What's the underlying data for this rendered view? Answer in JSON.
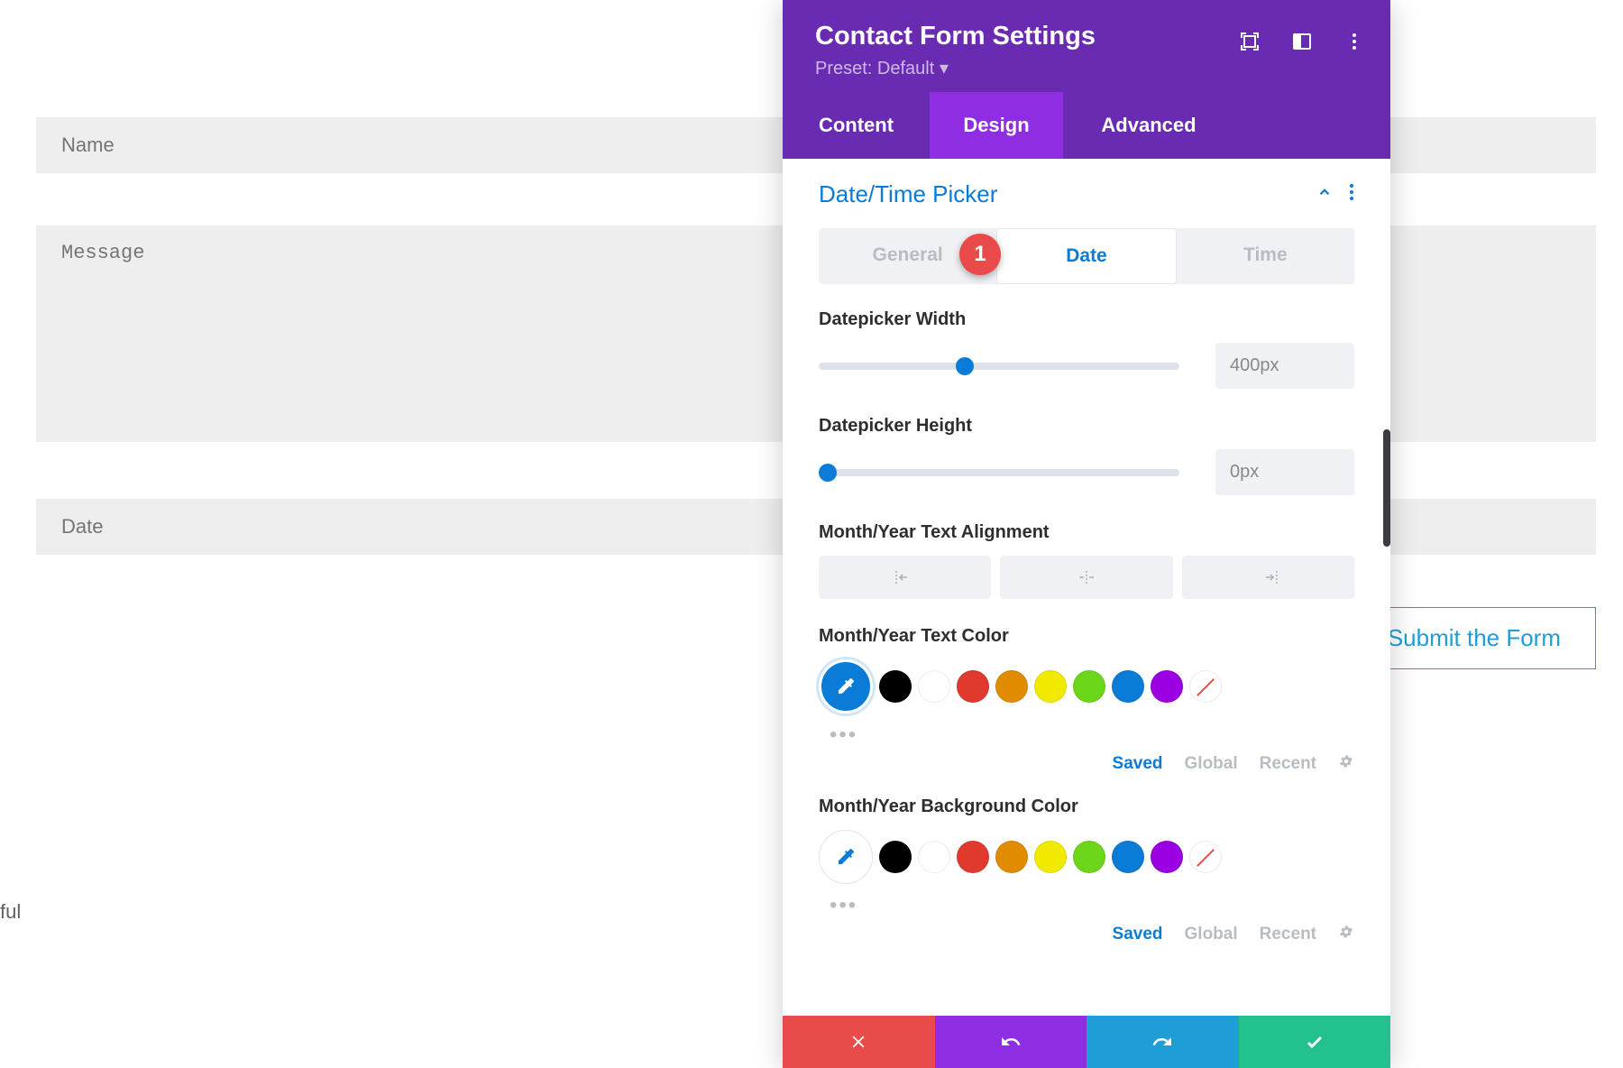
{
  "form": {
    "name_placeholder": "Name",
    "message_placeholder": "Message",
    "date_placeholder": "Date",
    "submit_label": "Submit the Form"
  },
  "partial_text": "ful",
  "panel": {
    "title": "Contact Form Settings",
    "preset": "Preset: Default",
    "tabs": {
      "content": "Content",
      "design": "Design",
      "advanced": "Advanced"
    },
    "section_title": "Date/Time Picker",
    "sub_tabs": {
      "general": "General",
      "date": "Date",
      "time": "Time"
    },
    "badge": "1",
    "datepicker_width": {
      "label": "Datepicker Width",
      "value": "400px",
      "slider_percent": 38
    },
    "datepicker_height": {
      "label": "Datepicker Height",
      "value": "0px",
      "slider_percent": 0
    },
    "alignment_label": "Month/Year Text Alignment",
    "text_color_label": "Month/Year Text Color",
    "bg_color_label": "Month/Year Background Color",
    "palette": [
      "#000000",
      "#ffffff",
      "#e03a2f",
      "#e08b00",
      "#f2e900",
      "#6cd61b",
      "#0a7bd6",
      "#9a00e2"
    ],
    "color_tabs": {
      "saved": "Saved",
      "global": "Global",
      "recent": "Recent"
    }
  }
}
